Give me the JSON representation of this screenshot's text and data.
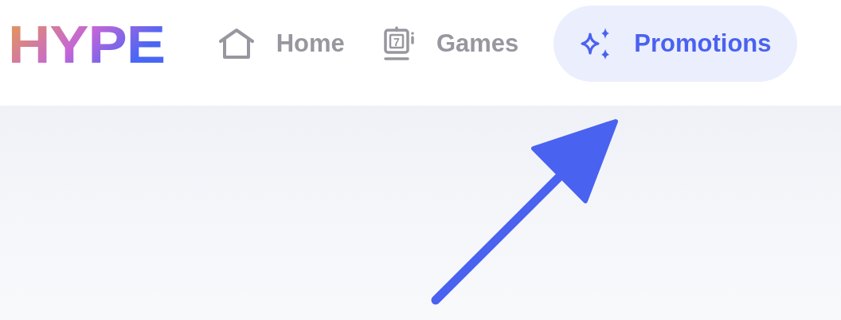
{
  "logo": "HYPE",
  "nav": [
    {
      "label": "Home",
      "selected": false
    },
    {
      "label": "Games",
      "icon_label": "7",
      "selected": false
    },
    {
      "label": "Promotions",
      "selected": true
    }
  ]
}
